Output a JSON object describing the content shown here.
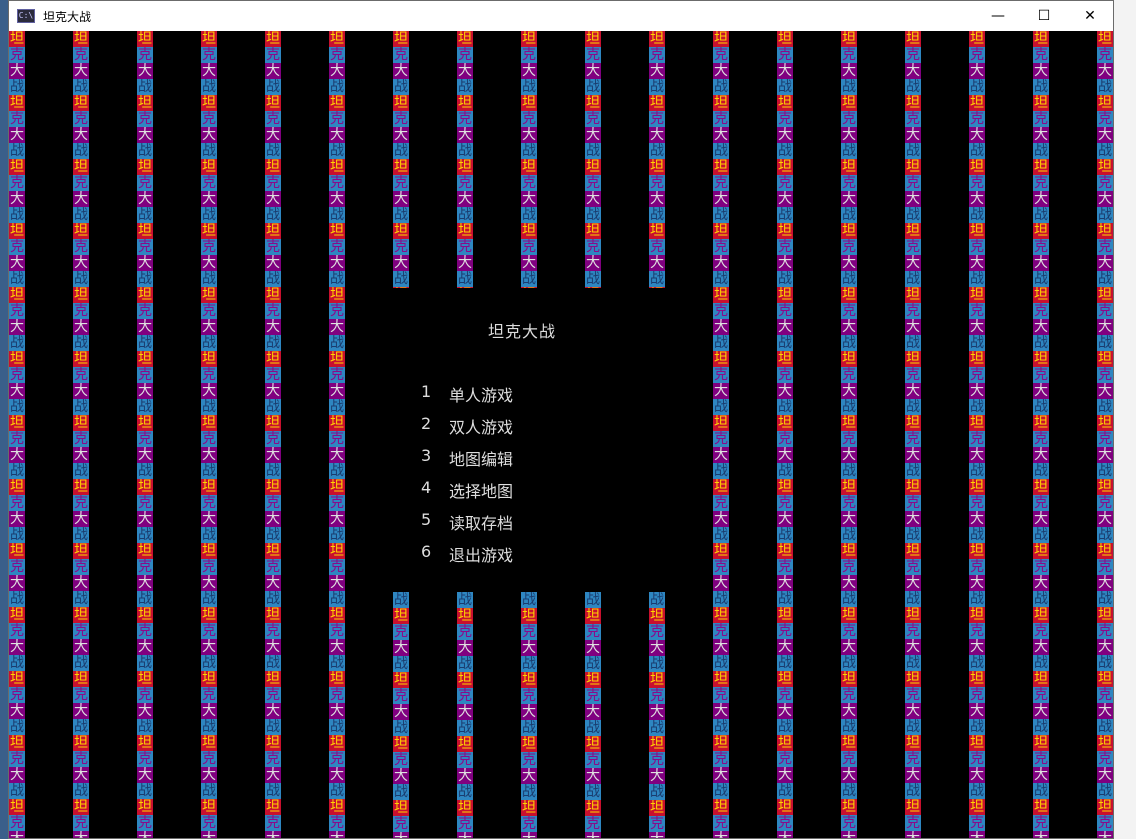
{
  "window": {
    "title": "坦克大战",
    "icon_label": "C:\\",
    "controls": {
      "minimize": "—",
      "maximize": "☐",
      "close": "✕"
    }
  },
  "game": {
    "menu_title": "坦克大战",
    "menu_items": [
      {
        "num": "1",
        "label": "单人游戏"
      },
      {
        "num": "2",
        "label": "双人游戏"
      },
      {
        "num": "3",
        "label": "地图编辑"
      },
      {
        "num": "4",
        "label": "选择地图"
      },
      {
        "num": "5",
        "label": "读取存档"
      },
      {
        "num": "6",
        "label": "退出游戏"
      }
    ],
    "tile_glyphs": [
      "坦",
      "克",
      "大",
      "战"
    ],
    "colors": {
      "tile_red": "#c8102e",
      "tile_blue": "#2e86c1",
      "tile_purple": "#800080",
      "menu_text": "#dddddd",
      "background": "#000000"
    }
  }
}
